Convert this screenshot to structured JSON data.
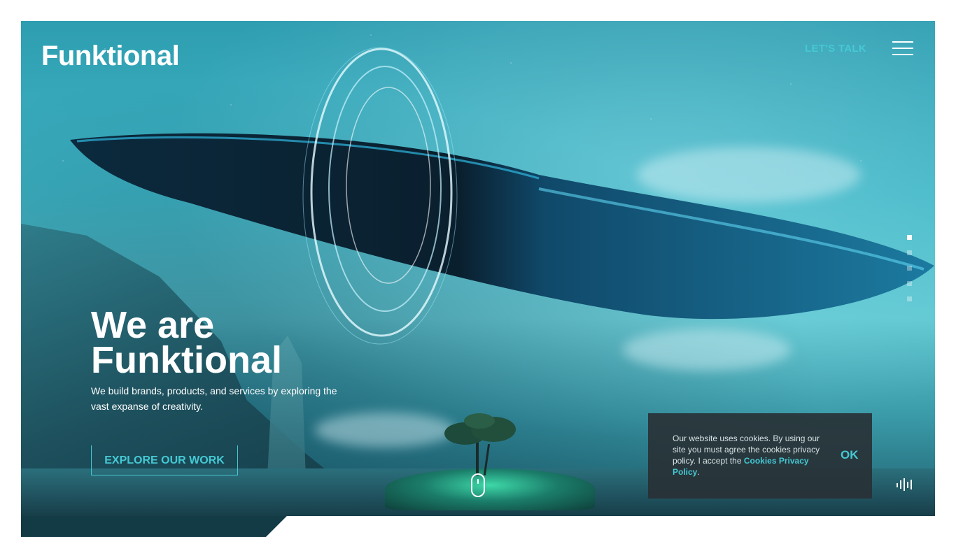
{
  "header": {
    "logo_text": "Funktional",
    "lets_talk": "LET'S TALK",
    "menu_icon": "hamburger-menu-icon"
  },
  "hero": {
    "headline_line1": "We are",
    "headline_line2": "Funktional",
    "tagline": "We build brands, products, and services by exploring the vast expanse of creativity.",
    "cta_label": "EXPLORE OUR WORK",
    "scroll_icon": "mouse-scroll-icon",
    "sound_icon": "sound-wave-icon",
    "active_slide": 1,
    "slide_count": 5
  },
  "cookie_banner": {
    "text_before_link": "Our website uses cookies. By using our site you must agree the cookies privacy policy. I accept the ",
    "link_text": "Cookies Privacy Policy",
    "text_after_link": ".",
    "ok_label": "OK"
  },
  "colors": {
    "accent": "#45c9d4",
    "text": "#ffffff",
    "cookie_bg": "#283034"
  }
}
